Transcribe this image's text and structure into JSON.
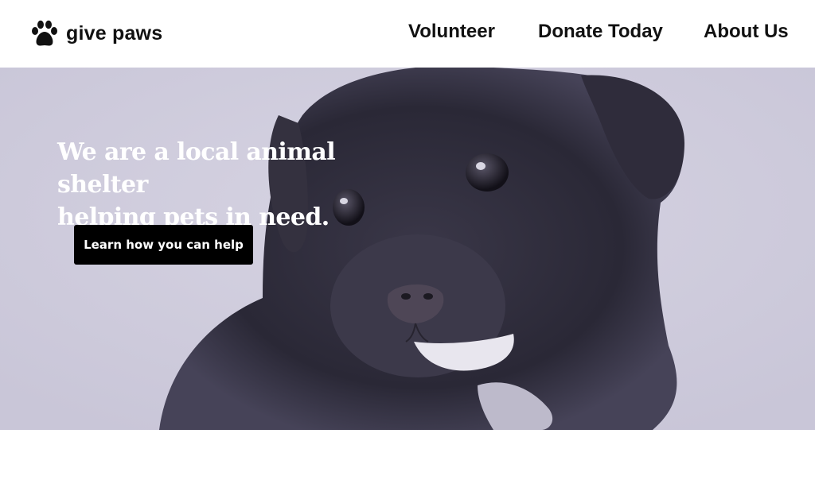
{
  "brand": {
    "name": "give paws",
    "logo_icon": "paw-print-icon"
  },
  "nav": {
    "items": [
      {
        "label": "Volunteer"
      },
      {
        "label": "Donate Today"
      },
      {
        "label": "About Us"
      }
    ]
  },
  "hero": {
    "headline_line1": "We are a local animal shelter",
    "headline_line2": "helping pets in need.",
    "cta_label": "Learn how you can help",
    "photo_subject": "black-puppy-photo",
    "overlay_color": "#cecbdc"
  },
  "colors": {
    "text": "#111111",
    "button_bg": "#000000",
    "button_text": "#ffffff",
    "hero_bg": "#cecbdc"
  }
}
